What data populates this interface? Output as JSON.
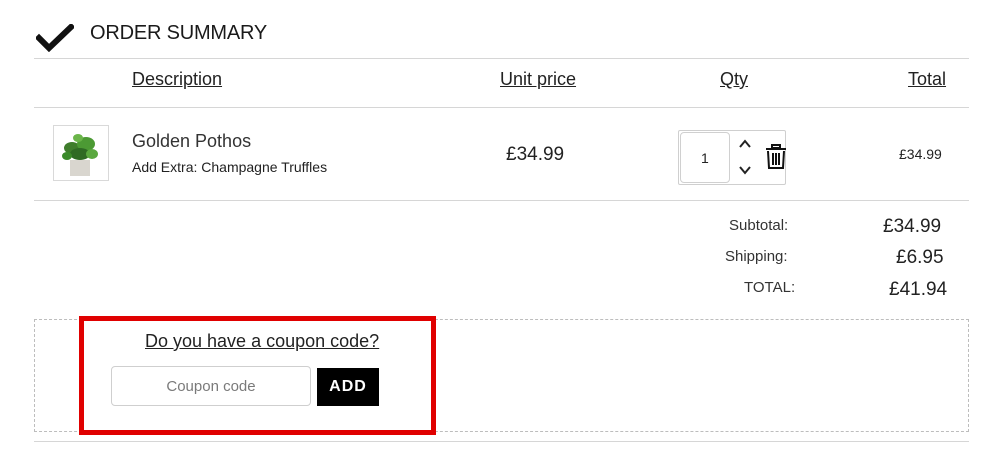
{
  "header": {
    "title": "ORDER SUMMARY",
    "icon": "checkmark-icon"
  },
  "columns": {
    "description": "Description",
    "unit_price": "Unit price",
    "qty": "Qty",
    "total": "Total"
  },
  "item": {
    "name": "Golden Pothos",
    "extra": "Add Extra: Champagne Truffles",
    "unit_price": "£34.99",
    "qty": "1",
    "total": "£34.99",
    "image": "plant-thumbnail"
  },
  "summary": {
    "subtotal_label": "Subtotal:",
    "subtotal_value": "£34.99",
    "shipping_label": "Shipping:",
    "shipping_value": "£6.95",
    "total_label": "TOTAL:",
    "total_value": "£41.94"
  },
  "coupon": {
    "link": "Do you have a coupon code?",
    "placeholder": "Coupon code",
    "button": "ADD"
  },
  "colors": {
    "highlight": "#e00000",
    "button_bg": "#000000"
  }
}
